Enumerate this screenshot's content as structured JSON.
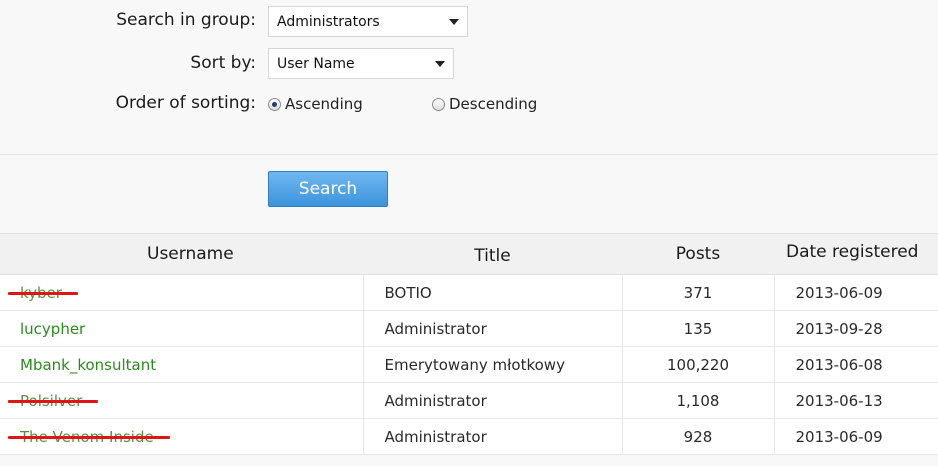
{
  "form": {
    "group_label": "Search in group:",
    "group_value": "Administrators",
    "sort_label": "Sort by:",
    "sort_value": "User Name",
    "order_label": "Order of sorting:",
    "order_ascending": "Ascending",
    "order_descending": "Descending",
    "order_selected": "Ascending"
  },
  "search_button": "Search",
  "table": {
    "headers": [
      "Username",
      "Title",
      "Posts",
      "Date registered"
    ],
    "rows": [
      {
        "username": "kyber",
        "title": "BOTIO",
        "posts": "371",
        "date": "2013-06-09",
        "struck": true
      },
      {
        "username": "lucypher",
        "title": "Administrator",
        "posts": "135",
        "date": "2013-09-28",
        "struck": false
      },
      {
        "username": "Mbank_konsultant",
        "title": "Emerytowany młotkowy",
        "posts": "100,220",
        "date": "2013-06-08",
        "struck": false
      },
      {
        "username": "Polsilver",
        "title": "Administrator",
        "posts": "1,108",
        "date": "2013-06-13",
        "struck": true
      },
      {
        "username": "The Venom Inside",
        "title": "Administrator",
        "posts": "928",
        "date": "2013-06-09",
        "struck": true
      }
    ]
  },
  "colors": {
    "username_link": "#2b8a1e",
    "strike_mark": "#e01515",
    "button": "#4a9de0"
  }
}
